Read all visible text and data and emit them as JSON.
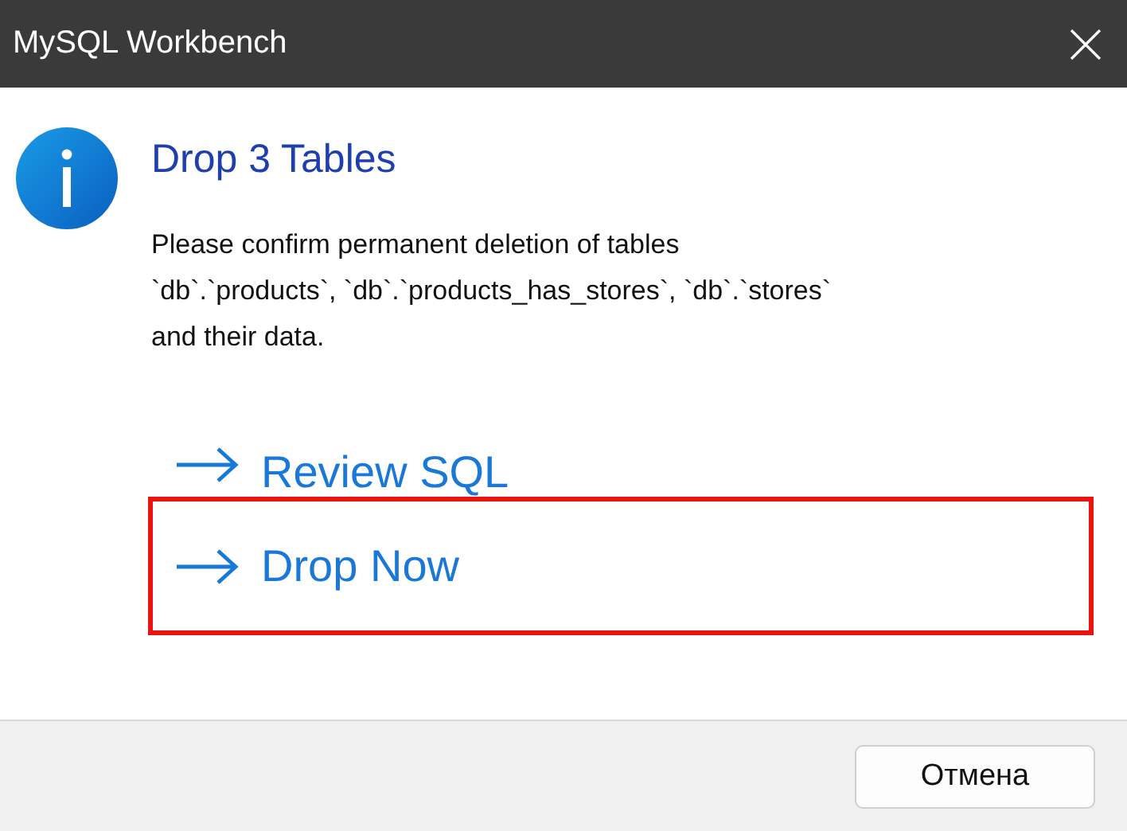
{
  "window": {
    "title": "MySQL Workbench"
  },
  "heading": "Drop 3 Tables",
  "message": [
    "Please confirm permanent deletion of tables",
    "`db`.`products`, `db`.`products_has_stores`, `db`.`stores`",
    "and their data."
  ],
  "options": [
    {
      "label": "Review SQL",
      "highlighted": false
    },
    {
      "label": "Drop Now",
      "highlighted": true
    }
  ],
  "buttons": [
    "Отмена"
  ]
}
